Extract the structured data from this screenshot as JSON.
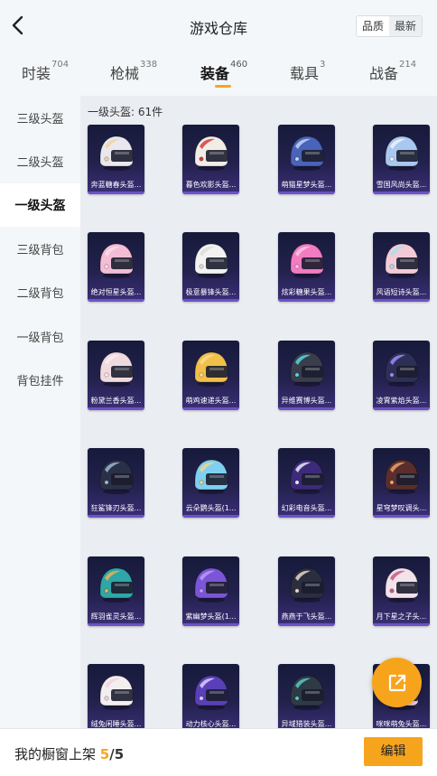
{
  "header": {
    "title": "游戏仓库",
    "sort_options": [
      "品质",
      "最新"
    ]
  },
  "tabs": [
    {
      "label": "时装",
      "count": "704"
    },
    {
      "label": "枪械",
      "count": "338"
    },
    {
      "label": "装备",
      "count": "460"
    },
    {
      "label": "载具",
      "count": "3"
    },
    {
      "label": "战备",
      "count": "214"
    }
  ],
  "active_tab": "装备",
  "sidebar": {
    "items": [
      "三级头盔",
      "二级头盔",
      "一级头盔",
      "三级背包",
      "二级背包",
      "一级背包",
      "背包挂件"
    ],
    "active": "一级头盔"
  },
  "section": {
    "title": "一级头盔: 61件"
  },
  "items": [
    {
      "name": "奔蓝糖春头盔...",
      "helmet_color": "#e8e8ee",
      "accent": "#f4d3a0"
    },
    {
      "name": "暮色欢影头盔...",
      "helmet_color": "#f1ede6",
      "accent": "#d83b3b"
    },
    {
      "name": "萌猫星梦头盔...",
      "helmet_color": "#4863b8",
      "accent": "#c8d4f2"
    },
    {
      "name": "雪国风尚头盔...",
      "helmet_color": "#a9c8f0",
      "accent": "#eef3fb"
    },
    {
      "name": "绝对恒星头盔...",
      "helmet_color": "#f3bdd6",
      "accent": "#f8dfe9"
    },
    {
      "name": "极意暴锋头盔...",
      "helmet_color": "#f2f2f2",
      "accent": "#dddddd"
    },
    {
      "name": "炫彩糖果头盔...",
      "helmet_color": "#f27bc1",
      "accent": "#f9c8e6"
    },
    {
      "name": "风语短诗头盔...",
      "helmet_color": "#f2cbd6",
      "accent": "#a8e0f2"
    },
    {
      "name": "粉黛兰香头盔...",
      "helmet_color": "#f0dadf",
      "accent": "#f7ecef"
    },
    {
      "name": "萌鸡速递头盔...",
      "helmet_color": "#f1c04a",
      "accent": "#f8dc8e"
    },
    {
      "name": "异维赛博头盔...",
      "helmet_color": "#3a3e4a",
      "accent": "#4fd8e8"
    },
    {
      "name": "凌霄紫焰头盔...",
      "helmet_color": "#2d3056",
      "accent": "#9d8cff"
    },
    {
      "name": "狂鲨锋刃头盔...",
      "helmet_color": "#2a3146",
      "accent": "#9fb4d6"
    },
    {
      "name": "云朵鹦头盔(1...",
      "helmet_color": "#7fd0f0",
      "accent": "#f2d58a"
    },
    {
      "name": "幻彩电音头盔...",
      "helmet_color": "#3d2a7a",
      "accent": "#e8e8f8"
    },
    {
      "name": "星穹梦叹调头...",
      "helmet_color": "#5a2e2a",
      "accent": "#f0a070"
    },
    {
      "name": "辉羽雀灵头盔...",
      "helmet_color": "#2fa6a8",
      "accent": "#e8b34a"
    },
    {
      "name": "紫幽梦头盔(1...",
      "helmet_color": "#7b55d8",
      "accent": "#b89cf2"
    },
    {
      "name": "燕燕于飞头盔...",
      "helmet_color": "#2b2e3e",
      "accent": "#e8d8c8"
    },
    {
      "name": "月下星之子头...",
      "helmet_color": "#f2e2ea",
      "accent": "#c65a8a"
    },
    {
      "name": "绒兔闲睡头盔...",
      "helmet_color": "#f3eef0",
      "accent": "#f6d2de"
    },
    {
      "name": "动力核心头盔...",
      "helmet_color": "#5a3fb8",
      "accent": "#d8d0ff"
    },
    {
      "name": "异域猎装头盔...",
      "helmet_color": "#2e3a44",
      "accent": "#58c8c8"
    },
    {
      "name": "咪咪萌兔头盔...",
      "helmet_color": "#f2d6e0",
      "accent": "#f7a8c2"
    }
  ],
  "footer": {
    "label": "我的橱窗上架",
    "current": "5",
    "total": "/5",
    "edit_label": "编辑"
  },
  "colors": {
    "accent": "#f7a41d",
    "card_bg": "#23214d",
    "card_bar": "#6c52c8"
  }
}
